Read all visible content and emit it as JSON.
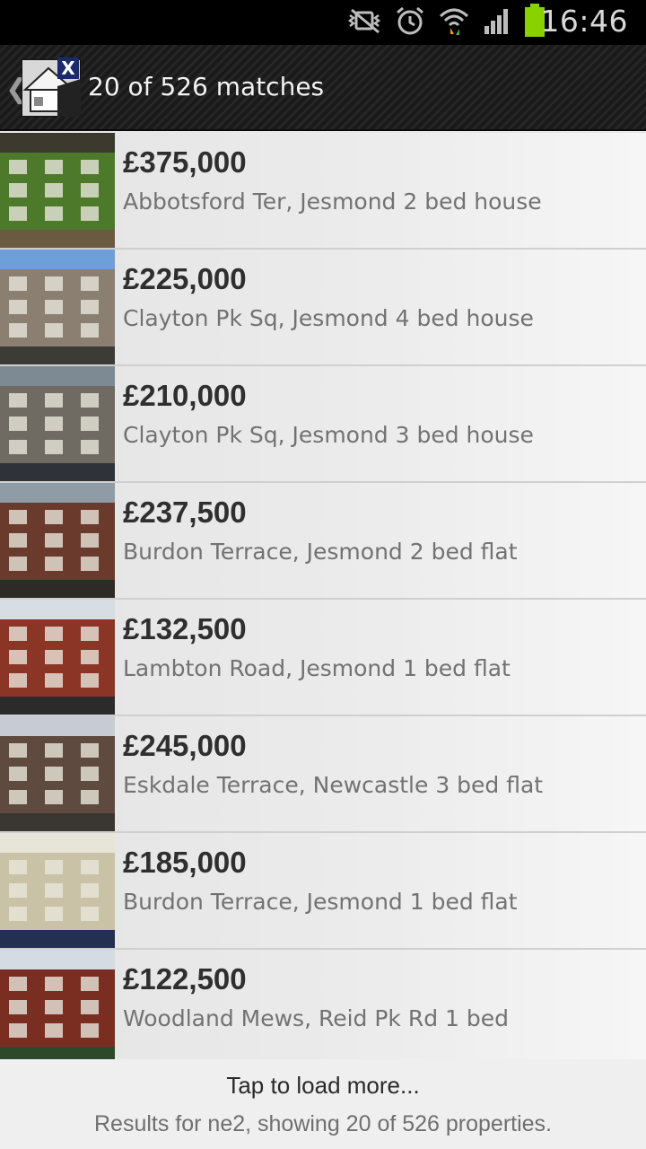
{
  "status_bar": {
    "time": "16:46",
    "icons": [
      "vibrate-muted-icon",
      "alarm-icon",
      "wifi-icon",
      "signal-icon",
      "battery-icon"
    ],
    "battery_color": "#8ad100",
    "wifi_arrow_colors": [
      "#f0a000",
      "#4caf50"
    ]
  },
  "action_bar": {
    "back_glyph": "❮",
    "logo_badge": "X",
    "title": "20 of 526 matches"
  },
  "listings": [
    {
      "price": "£375,000",
      "address": "Abbotsford Ter,  Jesmond 2 bed house",
      "thumb_colors": [
        "#3b3a2c",
        "#4d7a2a",
        "#6b5a42"
      ]
    },
    {
      "price": "£225,000",
      "address": "Clayton Pk Sq,  Jesmond 4 bed house",
      "thumb_colors": [
        "#6f9fd8",
        "#8a7f70",
        "#3d3b36"
      ]
    },
    {
      "price": "£210,000",
      "address": "Clayton Pk Sq,  Jesmond 3 bed house",
      "thumb_colors": [
        "#7d8a94",
        "#6f6b62",
        "#2f3238"
      ]
    },
    {
      "price": "£237,500",
      "address": "Burdon Terrace,  Jesmond 2 bed flat",
      "thumb_colors": [
        "#8f9ca6",
        "#6a3a2c",
        "#2e2a26"
      ]
    },
    {
      "price": "£132,500",
      "address": "Lambton Road,  Jesmond 1 bed flat",
      "thumb_colors": [
        "#d8dde4",
        "#8a3526",
        "#2b2b2b"
      ]
    },
    {
      "price": "£245,000",
      "address": "Eskdale Terrace,  Newcastle 3 bed flat",
      "thumb_colors": [
        "#c7ccd4",
        "#5e4a3e",
        "#3a3631"
      ]
    },
    {
      "price": "£185,000",
      "address": "Burdon Terrace,  Jesmond 1 bed flat",
      "thumb_colors": [
        "#e7e4d8",
        "#c9c2a6",
        "#243050"
      ]
    },
    {
      "price": "£122,500",
      "address": "Woodland Mews,  Reid Pk Rd 1 bed",
      "thumb_colors": [
        "#d5dbe3",
        "#7a2e22",
        "#2c4a2a"
      ]
    }
  ],
  "footer": {
    "load_more": "Tap to load more...",
    "results_summary": "Results for ne2, showing 20 of 526 properties."
  }
}
